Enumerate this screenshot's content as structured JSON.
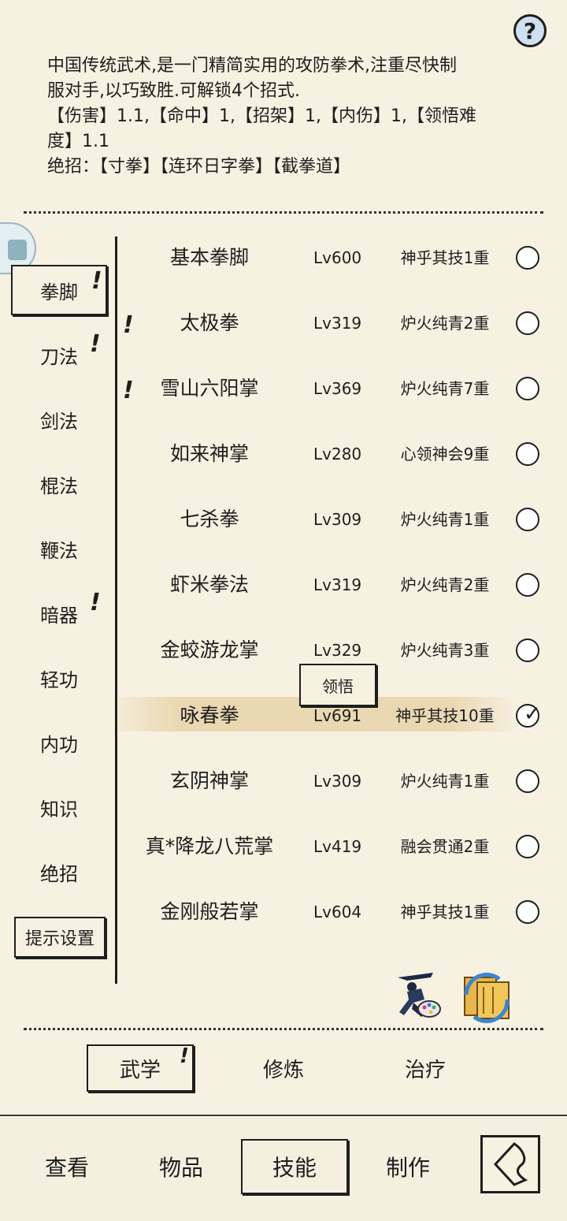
{
  "help": {
    "glyph": "?"
  },
  "description": {
    "line1": "中国传统武术,是一门精简实用的攻防拳术,注重尽快制",
    "line2": "服对手,以巧致胜.可解锁4个招式.",
    "line3": "【伤害】1.1,【命中】1,【招架】1,【内伤】1,【领悟难",
    "line4": "度】1.1",
    "line5": "绝招：【寸拳】【连环日字拳】【截拳道】"
  },
  "categories": [
    {
      "label": "拳脚",
      "mark": "!"
    },
    {
      "label": "刀法",
      "mark": "!"
    },
    {
      "label": "剑法",
      "mark": ""
    },
    {
      "label": "棍法",
      "mark": ""
    },
    {
      "label": "鞭法",
      "mark": ""
    },
    {
      "label": "暗器",
      "mark": "!"
    },
    {
      "label": "轻功",
      "mark": ""
    },
    {
      "label": "内功",
      "mark": ""
    },
    {
      "label": "知识",
      "mark": ""
    },
    {
      "label": "绝招",
      "mark": ""
    }
  ],
  "tip_settings_label": "提示设置",
  "skills": [
    {
      "name": "基本拳脚",
      "level": "Lv600",
      "rank": "神乎其技1重",
      "mark": ""
    },
    {
      "name": "太极拳",
      "level": "Lv319",
      "rank": "炉火纯青2重",
      "mark": "!"
    },
    {
      "name": "雪山六阳掌",
      "level": "Lv369",
      "rank": "炉火纯青7重",
      "mark": "!"
    },
    {
      "name": "如来神掌",
      "level": "Lv280",
      "rank": "心领神会9重",
      "mark": ""
    },
    {
      "name": "七杀拳",
      "level": "Lv309",
      "rank": "炉火纯青1重",
      "mark": ""
    },
    {
      "name": "虾米拳法",
      "level": "Lv319",
      "rank": "炉火纯青2重",
      "mark": ""
    },
    {
      "name": "金蛟游龙掌",
      "level": "Lv329",
      "rank": "炉火纯青3重",
      "mark": ""
    },
    {
      "name": "咏春拳",
      "level": "Lv691",
      "rank": "神乎其技10重",
      "mark": ""
    },
    {
      "name": "玄阴神掌",
      "level": "Lv309",
      "rank": "炉火纯青1重",
      "mark": ""
    },
    {
      "name": "真*降龙八荒掌",
      "level": "Lv419",
      "rank": "融会贯通2重",
      "mark": ""
    },
    {
      "name": "金刚般若掌",
      "level": "Lv604",
      "rank": "神乎其技1重",
      "mark": ""
    }
  ],
  "selected_skill_check": "✓",
  "comprehend_button": "领悟",
  "sub_tabs": [
    {
      "label": "武学",
      "mark": "!"
    },
    {
      "label": "修炼",
      "mark": ""
    },
    {
      "label": "治疗",
      "mark": ""
    }
  ],
  "nav_tabs": [
    {
      "label": "查看"
    },
    {
      "label": "物品"
    },
    {
      "label": "技能"
    },
    {
      "label": "制作"
    }
  ],
  "icons": {
    "help": "question-mark-icon",
    "side": "side-panel-icon",
    "fighter_palette": "fighter-palette-icon",
    "book_swap": "book-swap-icon",
    "back": "back-arrow-icon"
  }
}
